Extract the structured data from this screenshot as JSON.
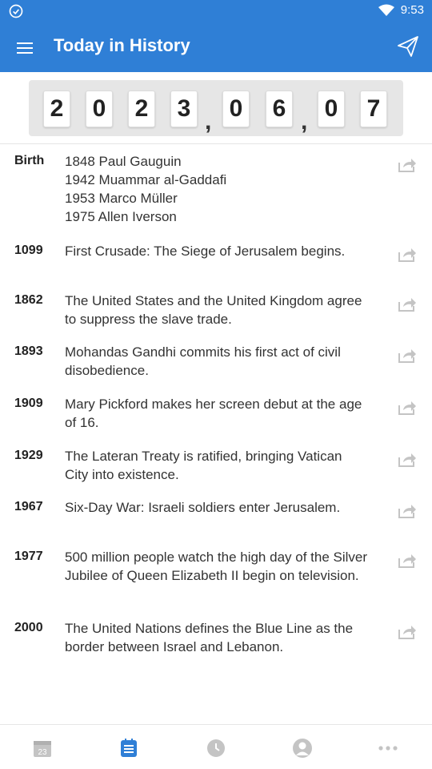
{
  "status_bar": {
    "time": "9:53",
    "left_icon": "check-circle-icon",
    "right_icons": [
      "wifi-icon"
    ]
  },
  "app_bar": {
    "title": "Today in History",
    "left_icon": "menu-icon",
    "right_icon": "send-icon"
  },
  "date": {
    "digits": [
      "2",
      "0",
      "2",
      "3",
      "0",
      "6",
      "0",
      "7"
    ],
    "separator": ","
  },
  "events": [
    {
      "year": "Birth",
      "text": "1848 Paul Gauguin\n1942 Muammar al-Gaddafi\n1953 Marco Müller\n1975 Allen Iverson"
    },
    {
      "year": "1099",
      "text": "First Crusade: The Siege of Jerusalem begins."
    },
    {
      "year": "1862",
      "text": "The United States and the United Kingdom agree to suppress the slave trade."
    },
    {
      "year": "1893",
      "text": "Mohandas Gandhi commits his first act of civil disobedience."
    },
    {
      "year": "1909",
      "text": "Mary Pickford makes her screen debut at the age of 16."
    },
    {
      "year": "1929",
      "text": "The Lateran Treaty is ratified, bringing Vatican City into existence."
    },
    {
      "year": "1967",
      "text": "Six-Day War: Israeli soldiers enter Jerusalem."
    },
    {
      "year": "1977",
      "text": "500 million people watch the high day of the Silver Jubilee of Queen Elizabeth II begin on television."
    },
    {
      "year": "2000",
      "text": "The United Nations defines the Blue Line as the border between Israel and Lebanon."
    }
  ],
  "bottom_nav": {
    "items": [
      {
        "icon": "calendar-date-icon",
        "label": "23",
        "active": false
      },
      {
        "icon": "list-icon",
        "active": true
      },
      {
        "icon": "clock-icon",
        "active": false
      },
      {
        "icon": "profile-icon",
        "active": false
      },
      {
        "icon": "more-icon",
        "active": false
      }
    ]
  },
  "colors": {
    "primary": "#2f7fd6",
    "inactive": "#c4c4c4",
    "text": "#333333"
  }
}
